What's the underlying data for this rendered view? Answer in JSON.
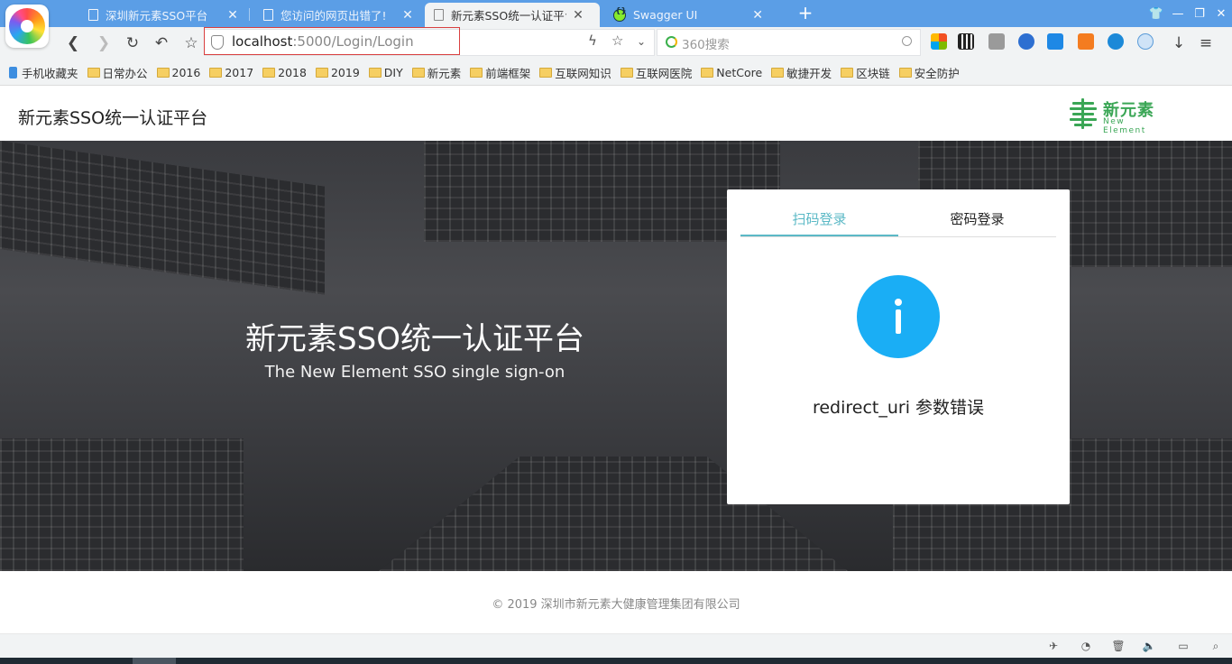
{
  "browser": {
    "tabs": [
      {
        "title": "深圳新元素SSO平台",
        "active": false
      },
      {
        "title": "您访问的网页出错了!",
        "active": false
      },
      {
        "title": "新元素SSO统一认证平台",
        "active": true
      },
      {
        "title": "Swagger UI",
        "active": false
      }
    ],
    "new_tab_icon": "plus-icon",
    "url_host": "localhost",
    "url_rest": ":5000/Login/Login",
    "search_placeholder": "360搜索",
    "bookmarks": [
      {
        "label": "手机收藏夹",
        "icon": "phone-icon"
      },
      {
        "label": "日常办公",
        "icon": "folder-icon"
      },
      {
        "label": "2016",
        "icon": "folder-icon"
      },
      {
        "label": "2017",
        "icon": "folder-icon"
      },
      {
        "label": "2018",
        "icon": "folder-icon"
      },
      {
        "label": "2019",
        "icon": "folder-icon"
      },
      {
        "label": "DIY",
        "icon": "folder-icon"
      },
      {
        "label": "新元素",
        "icon": "folder-icon"
      },
      {
        "label": "前端框架",
        "icon": "folder-icon"
      },
      {
        "label": "互联网知识",
        "icon": "folder-icon"
      },
      {
        "label": "互联网医院",
        "icon": "folder-icon"
      },
      {
        "label": "NetCore",
        "icon": "folder-icon"
      },
      {
        "label": "敏捷开发",
        "icon": "folder-icon"
      },
      {
        "label": "区块链",
        "icon": "folder-icon"
      },
      {
        "label": "安全防护",
        "icon": "folder-icon"
      }
    ]
  },
  "page": {
    "header_title": "新元素SSO统一认证平台",
    "brand": {
      "name": "新元素",
      "sub": "New Element"
    },
    "hero": {
      "title": "新元素SSO统一认证平台",
      "subtitle": "The New Element SSO single sign-on"
    },
    "login": {
      "tabs": [
        {
          "label": "扫码登录",
          "active": true
        },
        {
          "label": "密码登录",
          "active": false
        }
      ],
      "error_message": "redirect_uri 参数错误"
    },
    "footer": "© 2019  深圳市新元素大健康管理集团有限公司"
  },
  "colors": {
    "tabbar": "#5b9ee6",
    "accent_teal": "#5bb9c6",
    "info_blue": "#1aaef5",
    "brand_green": "#3aa655"
  }
}
